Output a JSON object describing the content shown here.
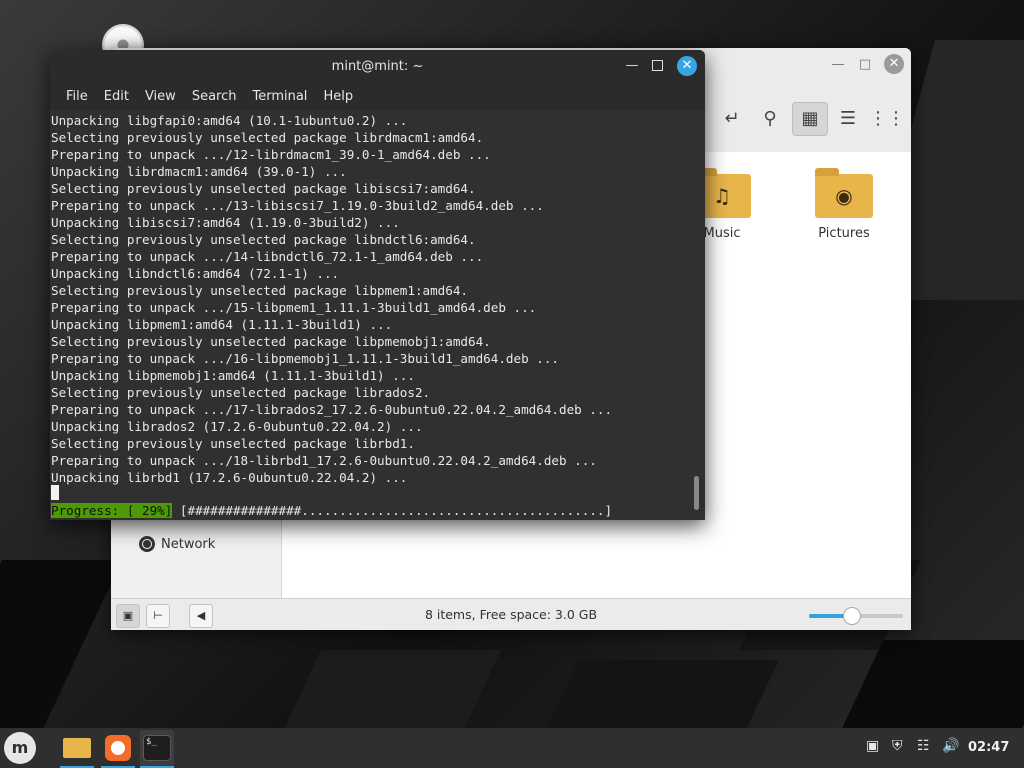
{
  "file_manager": {
    "sidebar": {
      "network_label": "Network"
    },
    "folders": [
      {
        "label": "Music",
        "icon": "music-note-icon"
      },
      {
        "label": "Pictures",
        "icon": "camera-icon"
      }
    ],
    "status": {
      "text": "8 items, Free space: 3.0 GB",
      "zoom_level": 0.45
    }
  },
  "terminal": {
    "title": "mint@mint: ~",
    "menu": [
      "File",
      "Edit",
      "View",
      "Search",
      "Terminal",
      "Help"
    ],
    "lines": [
      "Unpacking libgfapi0:amd64 (10.1-1ubuntu0.2) ...",
      "Selecting previously unselected package librdmacm1:amd64.",
      "Preparing to unpack .../12-librdmacm1_39.0-1_amd64.deb ...",
      "Unpacking librdmacm1:amd64 (39.0-1) ...",
      "Selecting previously unselected package libiscsi7:amd64.",
      "Preparing to unpack .../13-libiscsi7_1.19.0-3build2_amd64.deb ...",
      "Unpacking libiscsi7:amd64 (1.19.0-3build2) ...",
      "Selecting previously unselected package libndctl6:amd64.",
      "Preparing to unpack .../14-libndctl6_72.1-1_amd64.deb ...",
      "Unpacking libndctl6:amd64 (72.1-1) ...",
      "Selecting previously unselected package libpmem1:amd64.",
      "Preparing to unpack .../15-libpmem1_1.11.1-3build1_amd64.deb ...",
      "Unpacking libpmem1:amd64 (1.11.1-3build1) ...",
      "Selecting previously unselected package libpmemobj1:amd64.",
      "Preparing to unpack .../16-libpmemobj1_1.11.1-3build1_amd64.deb ...",
      "Unpacking libpmemobj1:amd64 (1.11.1-3build1) ...",
      "Selecting previously unselected package librados2.",
      "Preparing to unpack .../17-librados2_17.2.6-0ubuntu0.22.04.2_amd64.deb ...",
      "Unpacking librados2 (17.2.6-0ubuntu0.22.04.2) ...",
      "Selecting previously unselected package librbd1.",
      "Preparing to unpack .../18-librbd1_17.2.6-0ubuntu0.22.04.2_amd64.deb ...",
      "Unpacking librbd1 (17.2.6-0ubuntu0.22.04.2) ..."
    ],
    "progress_label": "Progress: [ 29%]",
    "progress_bar": "[###############........................................]"
  },
  "taskbar": {
    "clock": "02:47",
    "apps": [
      "files-icon",
      "firefox-icon",
      "terminal-icon"
    ],
    "tray": [
      "update-manager-icon",
      "shield-icon",
      "network-icon",
      "volume-icon"
    ],
    "accent": "#3aa5e4"
  }
}
